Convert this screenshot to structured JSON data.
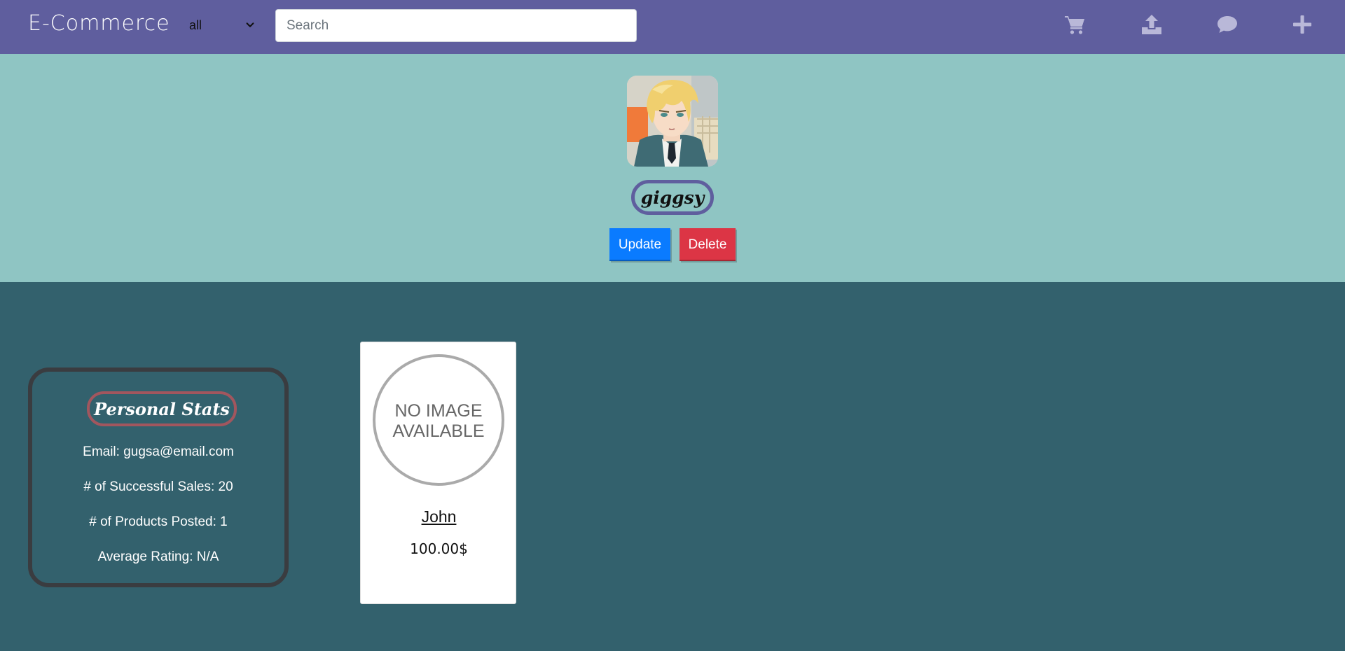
{
  "navbar": {
    "brand": "E-Commerce",
    "category": {
      "selected": "all"
    },
    "search": {
      "placeholder": "Search",
      "value": ""
    },
    "icons": [
      "cart-icon",
      "upload-icon",
      "chat-icon",
      "plus-icon"
    ]
  },
  "profile": {
    "username": "giggsy",
    "update_label": "Update",
    "delete_label": "Delete"
  },
  "stats": {
    "title": "Personal Stats",
    "email": "Email: gugsa@email.com",
    "sales": "# of Successful Sales: 20",
    "products": "# of Products Posted: 1",
    "rating": "Average Rating: N/A"
  },
  "products": [
    {
      "placeholder_line1": "NO IMAGE",
      "placeholder_line2": "AVAILABLE",
      "name": "John",
      "price": "100.00$"
    }
  ],
  "colors": {
    "navbar": "#5f5e9e",
    "header": "#8fc5c3",
    "body": "#33616d",
    "update": "#0a7bff",
    "delete": "#dc3545"
  }
}
